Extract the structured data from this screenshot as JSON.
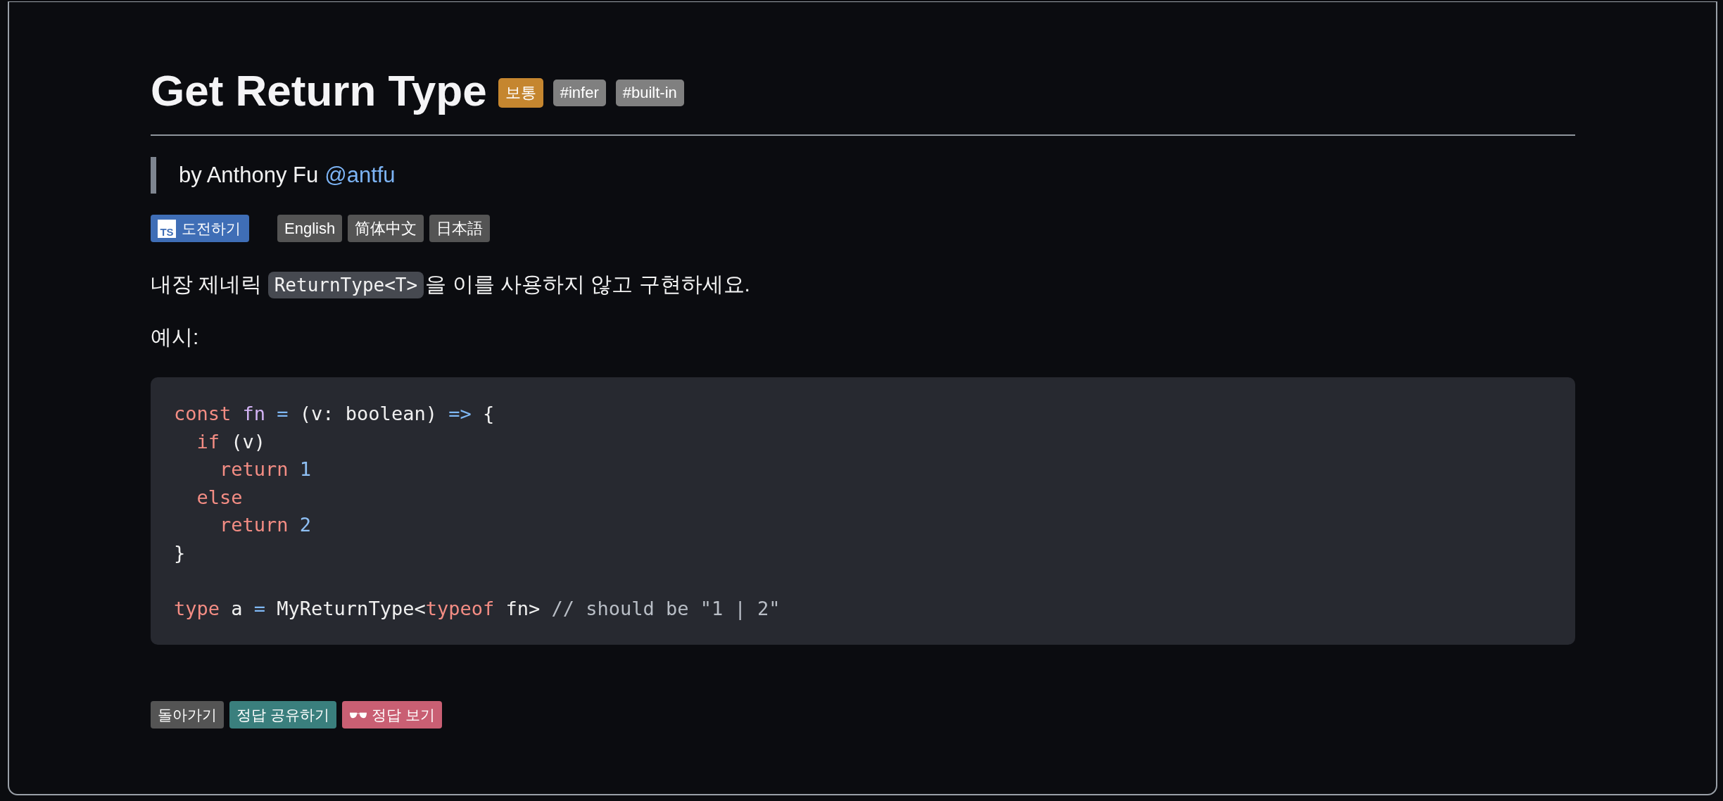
{
  "title": "Get Return Type",
  "badges": [
    {
      "text": "보통",
      "color": "#c5862f"
    },
    {
      "text": "#infer",
      "color": "#808080"
    },
    {
      "text": "#built-in",
      "color": "#808080"
    }
  ],
  "author": {
    "prefix": "by Anthony Fu",
    "handle": "@antfu"
  },
  "challenge_button": {
    "icon": "TS",
    "label": "도전하기"
  },
  "languages": [
    "English",
    "简体中文",
    "日本語"
  ],
  "description": [
    {
      "kind": "text",
      "text": "내장 제네릭 "
    },
    {
      "kind": "code",
      "text": "ReturnType<T>"
    },
    {
      "kind": "text",
      "text": "을 이를 사용하지 않고 구현하세요."
    }
  ],
  "example_label": "예시:",
  "code_paragraphs": [
    [
      [
        {
          "kind": "keyword",
          "text": "const"
        },
        {
          "kind": "name",
          "text": " fn"
        },
        {
          "kind": "operator",
          "text": " ="
        },
        {
          "kind": "plain",
          "text": " (v: boolean) "
        },
        {
          "kind": "operator",
          "text": "=>"
        },
        {
          "kind": "plain",
          "text": " {"
        }
      ],
      [
        {
          "kind": "keyword",
          "text": "  if"
        },
        {
          "kind": "plain",
          "text": " (v)"
        }
      ],
      [
        {
          "kind": "keyword",
          "text": "    return"
        },
        {
          "kind": "number",
          "text": " 1"
        }
      ],
      [
        {
          "kind": "keyword",
          "text": "  else"
        }
      ],
      [
        {
          "kind": "keyword",
          "text": "    return"
        },
        {
          "kind": "number",
          "text": " 2"
        }
      ],
      [
        {
          "kind": "plain",
          "text": "}"
        }
      ]
    ],
    [
      [
        {
          "kind": "keyword",
          "text": "type"
        },
        {
          "kind": "plain",
          "text": " a "
        },
        {
          "kind": "operator",
          "text": "="
        },
        {
          "kind": "plain",
          "text": " MyReturnType<"
        },
        {
          "kind": "keyword",
          "text": "typeof"
        },
        {
          "kind": "plain",
          "text": " fn> "
        },
        {
          "kind": "comment",
          "text": "// should be \"1 | 2\""
        }
      ]
    ]
  ],
  "actions": [
    {
      "label": "돌아가기",
      "color": "#545454",
      "icon": false
    },
    {
      "label": "정답 공유하기",
      "color": "#3a7f7d",
      "icon": false
    },
    {
      "label": "정답 보기",
      "color": "#c95f73",
      "icon": true
    }
  ]
}
